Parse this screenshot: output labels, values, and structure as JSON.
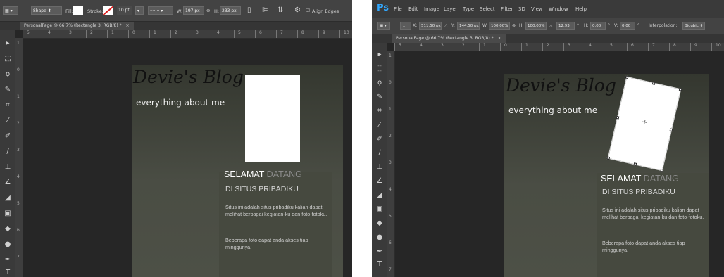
{
  "left": {
    "options_bar": {
      "shape_label": "Shape",
      "fill_label": "Fill:",
      "stroke_label": "Stroke:",
      "stroke_size": "10 pt",
      "width_label": "W:",
      "width_value": "197 px",
      "height_label": "H:",
      "height_value": "233 px",
      "align_edges_label": "Align Edges"
    },
    "doc_tab": "PersonalPage @ 66.7% (Rectangle 3, RGB/8) *",
    "ruler_h": [
      "5",
      "4",
      "3",
      "2",
      "1",
      "0",
      "1",
      "2",
      "3",
      "4",
      "5",
      "6",
      "7",
      "8",
      "9",
      "10"
    ],
    "ruler_v": [
      "1",
      "0",
      "1",
      "2",
      "3",
      "4",
      "5",
      "6",
      "7"
    ]
  },
  "right": {
    "menu": [
      "File",
      "Edit",
      "Image",
      "Layer",
      "Type",
      "Select",
      "Filter",
      "3D",
      "View",
      "Window",
      "Help"
    ],
    "ps_logo": "Ps",
    "options_bar": {
      "x_label": "X:",
      "x_value": "511.50 px",
      "y_label": "Y:",
      "y_value": "144.50 px",
      "w_label": "W:",
      "w_value": "100.00%",
      "h_label": "H:",
      "h_value": "100.00%",
      "angle_value": "12.93",
      "deg": "°",
      "hskew_label": "H:",
      "hskew_value": "0.00",
      "vskew_label": "V:",
      "vskew_value": "0.00",
      "interp_label": "Interpolation:",
      "interp_value": "Bicubic"
    },
    "doc_tab": "PersonalPage @ 66.7% (Rectangle 3, RGB/8) *",
    "ruler_h": [
      "5",
      "4",
      "3",
      "2",
      "1",
      "0",
      "1",
      "2",
      "3",
      "4",
      "5",
      "6",
      "7",
      "8",
      "9",
      "10"
    ],
    "ruler_v": [
      "1",
      "0",
      "1",
      "2",
      "3",
      "4",
      "5",
      "6",
      "7"
    ]
  },
  "page": {
    "title": "Devie's Blog",
    "subtitle": "everything about me",
    "welcome_a": "SELAMAT",
    "welcome_b": " DATANG",
    "site_line": "DI SITUS PRIBADIKU",
    "para1": "Situs ini adalah situs pribadiku kalian dapat melihat berbagai kegiatan-ku dan foto-fotoku.",
    "para2": "Beberapa foto dapat anda akses tiap minggunya."
  },
  "colors": {
    "canvas_bg": "#262626",
    "options_bg": "#434343",
    "page_gradient_top": "#34372f",
    "page_gradient_bottom": "#4d5046",
    "ps_blue": "#31a8ff"
  },
  "rotation_angle_deg": 12.93
}
